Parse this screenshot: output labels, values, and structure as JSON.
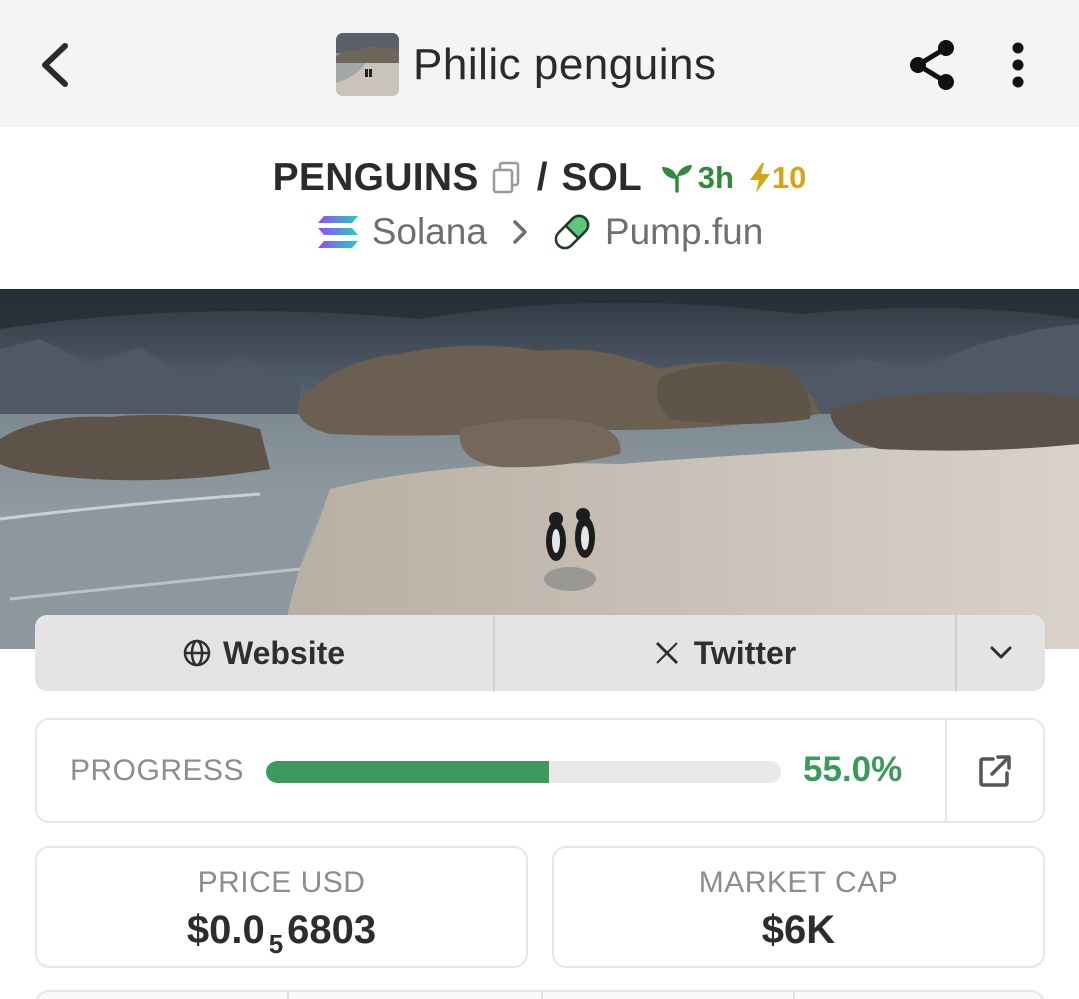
{
  "header": {
    "title": "Philic penguins",
    "back_icon": "chevron-left-icon",
    "share_icon": "share-icon",
    "more_icon": "more-vertical-icon"
  },
  "pair": {
    "base": "PENGUINS",
    "separator": "/",
    "quote": "SOL",
    "age": "3h",
    "boosts": "10",
    "chain": "Solana",
    "dex": "Pump.fun"
  },
  "links": {
    "website": "Website",
    "twitter": "Twitter"
  },
  "progress": {
    "label": "PROGRESS",
    "value_text": "55.0%",
    "fraction": 0.55
  },
  "stats": {
    "price_label": "PRICE USD",
    "price_prefix": "$0.0",
    "price_zeros": "5",
    "price_suffix": "6803",
    "mcap_label": "MARKET CAP",
    "mcap_value": "$6K"
  },
  "colors": {
    "accent_green": "#3b9a5c",
    "age_green": "#2f8a3c",
    "boost_yellow": "#d4a514",
    "topbar_bg": "#f4f4f4"
  }
}
